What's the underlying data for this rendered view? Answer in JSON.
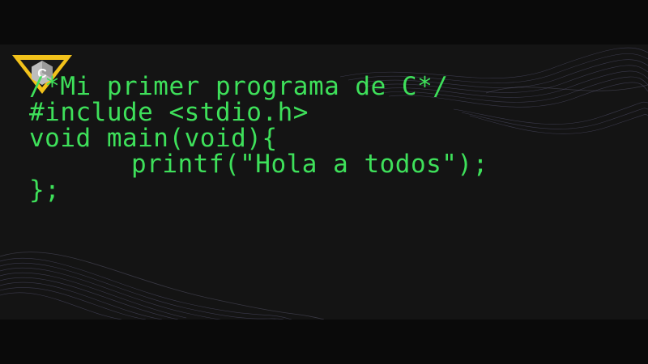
{
  "logo": {
    "letter": "C",
    "icon": "c-language-logo-icon",
    "colors": {
      "triangle": "#f2c21b",
      "hexagon": "#bdbdbd",
      "letter": "#ffffff"
    }
  },
  "code": {
    "lines": [
      {
        "text": "/*Mi primer programa de C*/",
        "indent": false
      },
      {
        "text": "#include <stdio.h>",
        "indent": false
      },
      {
        "text": "void main(void){",
        "indent": false
      },
      {
        "text": "printf(\"Hola a todos\");",
        "indent": true
      },
      {
        "text": "};",
        "indent": false
      }
    ]
  },
  "colors": {
    "background": "#0a0a0a",
    "panel": "#141414",
    "code_text": "#3ee05a",
    "wave_lines": "#5a5878"
  }
}
